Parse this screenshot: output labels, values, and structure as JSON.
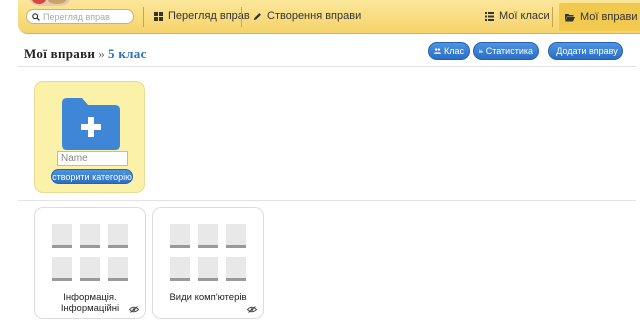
{
  "nav": {
    "search_placeholder": "Перегляд вправ",
    "browse_label": "Перегляд вправ",
    "create_label": "Створення вправи",
    "classes_label": "Мої класи",
    "exercises_label": "Мої вправи"
  },
  "header": {
    "title": "Мої вправи",
    "separator": "»",
    "crumb": "5 клас"
  },
  "actions": {
    "class_label": "Клас",
    "stats_label": "Статистика",
    "add_label": "Додати вправу"
  },
  "new_category": {
    "name_placeholder": "Name",
    "button_label": "створити категорію"
  },
  "exercises": [
    {
      "label": "Інформація. Інформаційні"
    },
    {
      "label": "Види комп'ютерів"
    }
  ],
  "colors": {
    "nav_bg": "#f6d36b",
    "accent_blue": "#2a6fc6",
    "folder_blue": "#3f86d6",
    "tile_yellow": "#fbf1a9"
  }
}
